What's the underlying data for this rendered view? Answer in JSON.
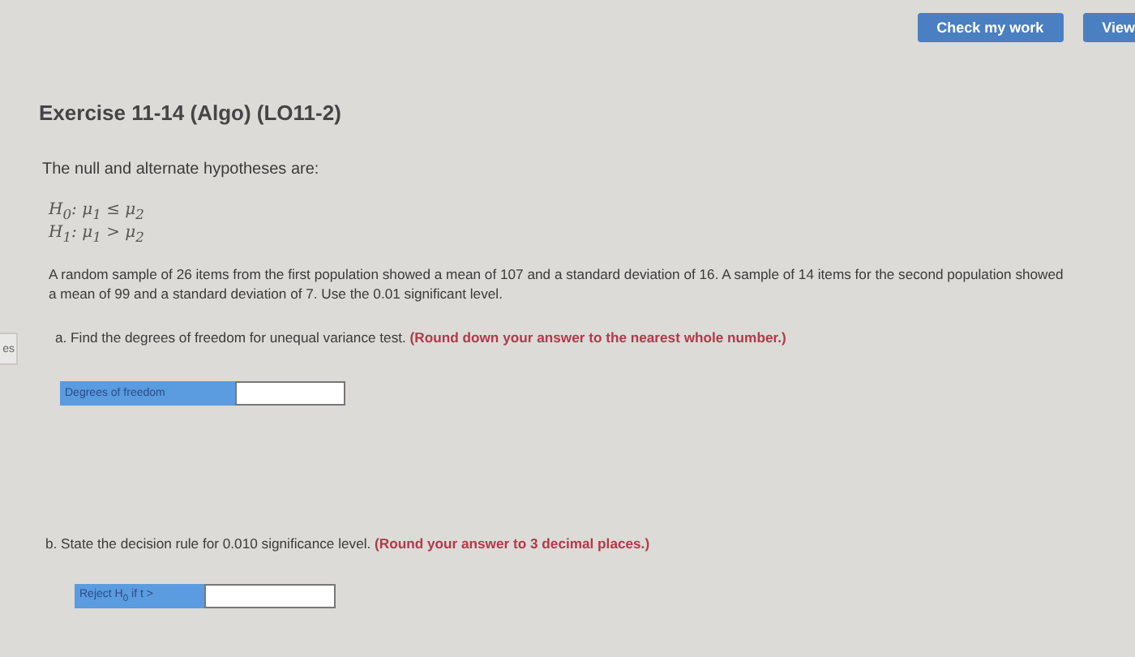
{
  "toolbar": {
    "buttons": [
      {
        "label": "Check my work"
      },
      {
        "label": "View"
      }
    ]
  },
  "side_tab": {
    "label": "es"
  },
  "exercise": {
    "title": "Exercise 11-14 (Algo) (LO11-2)",
    "intro": "The null and alternate hypotheses are:",
    "hypotheses": [
      "H$_{0}$: μ$_{1}$ ≤ μ$_{2}$",
      "H$_{1}$: μ$_{1}$ > μ$_{2}$"
    ],
    "problem": "A random sample of 26 items from the first population showed a mean of 107 and a standard deviation of 16. A sample of 14 items for the second population showed a mean of 99 and a standard deviation of 7. Use the 0.01 significant level.",
    "parts": [
      {
        "question": "a. Find the degrees of freedom for unequal variance test.",
        "note": "(Round down your answer to the nearest whole number.)",
        "answer_label": "Degrees of freedom"
      },
      {
        "question": "b. State the decision rule for 0.010 significance level.",
        "note": "(Round your answer to 3 decimal places.)",
        "answer_label": "Reject H$_{0}$ if t >"
      }
    ]
  }
}
